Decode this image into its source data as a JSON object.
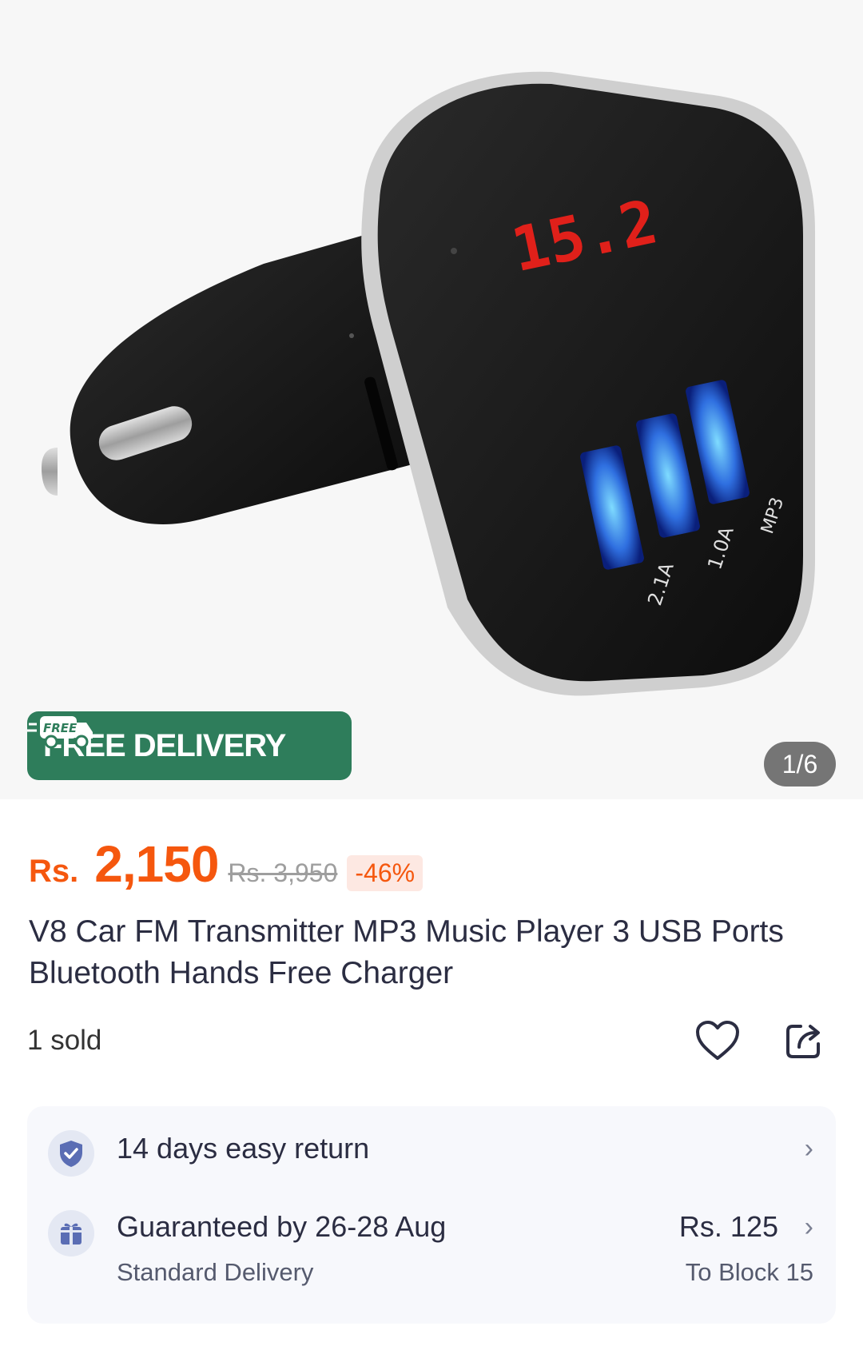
{
  "product_image": {
    "counter": "1/6",
    "display_reading": "15.2",
    "port_labels": [
      "2.1A",
      "1.0A",
      "MP3"
    ],
    "badge": {
      "logo_text": "FREE",
      "label": "FREE DELIVERY",
      "color": "#2e7d5b"
    }
  },
  "pricing": {
    "currency": "Rs.",
    "price": "2,150",
    "original_price": "Rs. 3,950",
    "discount": "-46%",
    "accent_color": "#f5570e"
  },
  "product": {
    "title": "V8 Car FM Transmitter MP3 Music Player 3 USB Ports Bluetooth Hands Free Charger",
    "sold": "1 sold"
  },
  "actions": {
    "wishlist_icon": "heart-icon",
    "share_icon": "share-icon"
  },
  "services": {
    "return": {
      "icon": "shield-check-icon",
      "label": "14 days easy return"
    },
    "delivery": {
      "icon": "gift-box-icon",
      "label": "Guaranteed by 26-28 Aug",
      "type": "Standard Delivery",
      "fee": "Rs. 125",
      "destination": "To Block 15"
    }
  }
}
